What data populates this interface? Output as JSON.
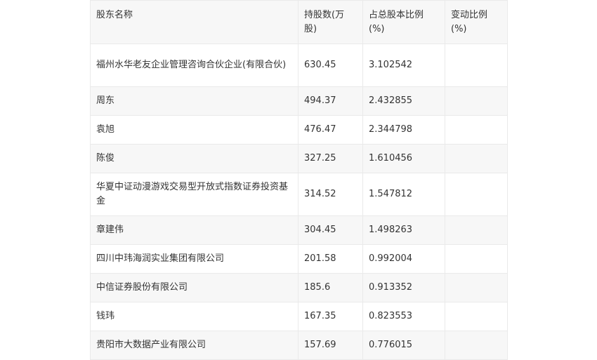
{
  "table": {
    "headers": [
      "股东名称",
      "持股数(万股)",
      "占总股本比例(%)",
      "变动比例(%)"
    ],
    "rows": [
      [
        "福州水华老友企业管理咨询合伙企业(有限合伙)",
        "630.45",
        "3.102542",
        ""
      ],
      [
        "周东",
        "494.37",
        "2.432855",
        ""
      ],
      [
        "袁旭",
        "476.47",
        "2.344798",
        ""
      ],
      [
        "陈俊",
        "327.25",
        "1.610456",
        ""
      ],
      [
        "华夏中证动漫游戏交易型开放式指数证券投资基金",
        "314.52",
        "1.547812",
        ""
      ],
      [
        "章建伟",
        "304.45",
        "1.498263",
        ""
      ],
      [
        "四川中玮海润实业集团有限公司",
        "201.58",
        "0.992004",
        ""
      ],
      [
        "中信证券股份有限公司",
        "185.6",
        "0.913352",
        ""
      ],
      [
        "钱玮",
        "167.35",
        "0.823553",
        ""
      ],
      [
        "贵阳市大数据产业有限公司",
        "157.69",
        "0.776015",
        ""
      ]
    ]
  }
}
